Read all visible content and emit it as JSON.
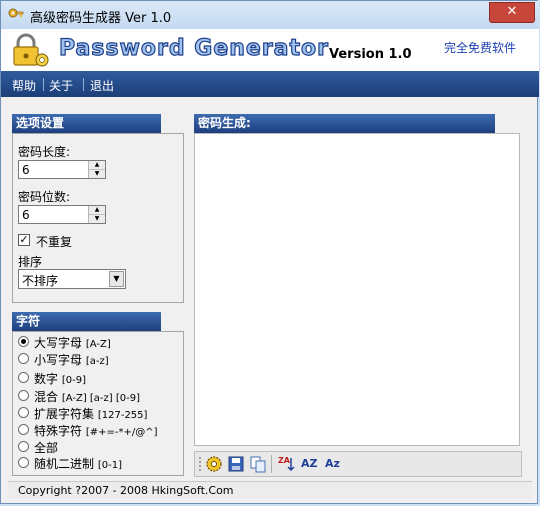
{
  "window": {
    "title": "高级密码生成器 Ver 1.0",
    "close_glyph": "✕"
  },
  "banner": {
    "logo_text": "Password Generator",
    "version": "Version 1.0",
    "free_link": "完全免费软件"
  },
  "menu": {
    "items": [
      "帮助",
      "关于",
      "退出"
    ]
  },
  "options": {
    "header": "选项设置",
    "length_label": "密码长度:",
    "length_value": "6",
    "count_label": "密码位数:",
    "count_value": "6",
    "no_repeat_label": "不重复",
    "no_repeat_checked": true,
    "sort_label": "排序",
    "sort_value": "不排序"
  },
  "charset": {
    "header": "字符",
    "items": [
      {
        "label": "大写字母",
        "hint": "[A-Z]",
        "selected": true
      },
      {
        "label": "小写字母",
        "hint": "[a-z]",
        "selected": false
      },
      {
        "label": "数字",
        "hint": "[0-9]",
        "selected": false
      },
      {
        "label": "混合",
        "hint": "[A-Z] [a-z] [0-9]",
        "selected": false
      },
      {
        "label": "扩展字符集",
        "hint": "[127-255]",
        "selected": false
      },
      {
        "label": "特殊字符",
        "hint": "[#+=-*+/@^]",
        "selected": false
      },
      {
        "label": "全部",
        "hint": "",
        "selected": false
      },
      {
        "label": "随机二进制",
        "hint": "[0-1]",
        "selected": false
      }
    ]
  },
  "output": {
    "header": "密码生成:",
    "content": ""
  },
  "toolbar": {
    "icons": [
      "generate-icon",
      "save-icon",
      "copy-icon",
      "sort-descending-icon",
      "uppercase-icon",
      "capitalize-icon"
    ],
    "az_desc": "ZA",
    "az_upper": "AZ",
    "az_cap": "Az"
  },
  "status": {
    "copyright": "Copyright ?2007 - 2008 HkingSoft.Com"
  },
  "colors": {
    "header_blue": "#2d5aa0",
    "menubar": "#2f5c9e",
    "link": "#1e3fb0"
  }
}
